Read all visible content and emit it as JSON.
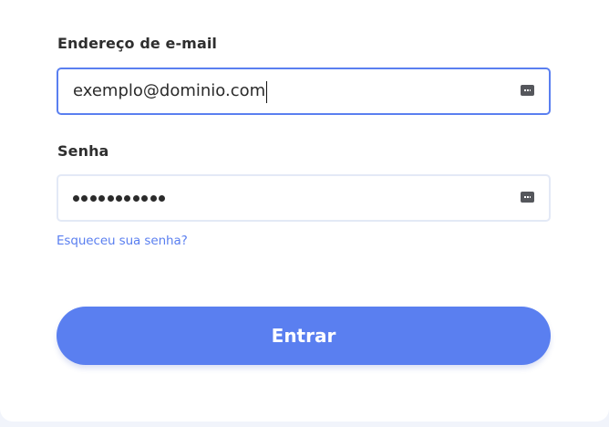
{
  "form": {
    "email_label": "Endereço de e-mail",
    "email_value": "exemplo@dominio.com",
    "password_label": "Senha",
    "password_masked_length": 11,
    "forgot_link": "Esqueceu sua senha?",
    "submit_label": "Entrar"
  },
  "icons": {
    "field_autofill": "keyboard-icon"
  },
  "colors": {
    "accent": "#5a7ff0",
    "field_border_focus": "#5a7ff0",
    "field_border": "#e3e9f6",
    "page_background": "#f1f4fb",
    "card_background": "#ffffff",
    "text": "#2e2e2e"
  }
}
